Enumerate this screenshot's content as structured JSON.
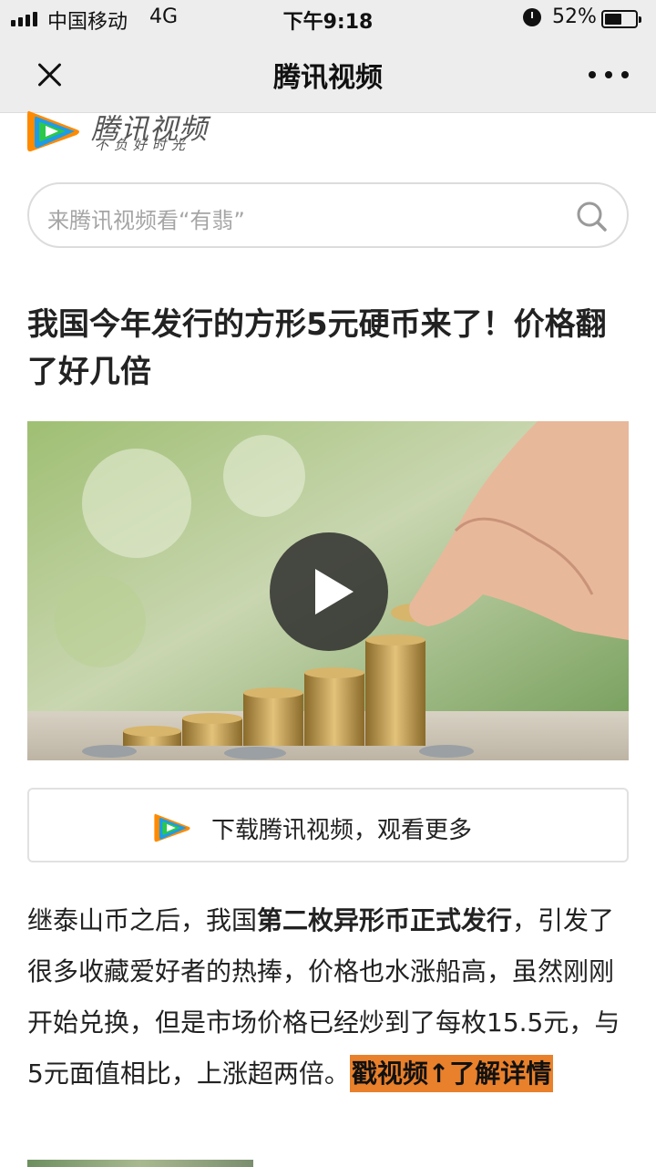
{
  "status_bar": {
    "carrier": "中国移动",
    "network": "4G",
    "time": "下午9:18",
    "battery": "52%",
    "battery_level": 0.52
  },
  "nav": {
    "title": "腾讯视频",
    "close_icon": "close-icon",
    "more_icon": "more-icon"
  },
  "logo": {
    "name": "腾讯视频",
    "slogan": "不负好时光"
  },
  "search": {
    "placeholder": "来腾讯视频看“有翡”"
  },
  "article": {
    "headline": "我国今年发行的方形5元硬币来了！价格翻了好几倍",
    "body_start": "继泰山币之后，我国",
    "body_bold": "第二枚异形币正式发行",
    "body_rest": "，引发了很多收藏爱好者的热捧，价格也水涨船高，虽然刚刚开始兑换，但是市场价格已经炒到了每枚15.5元，与5元面值相比，上涨超两倍。",
    "cta": "戳视频↑了解详情"
  },
  "video": {
    "play_icon": "play-icon"
  },
  "download": {
    "label": "下载腾讯视频，观看更多"
  },
  "colors": {
    "cta_bg": "#e9802b",
    "logo_orange": "#ff8a00",
    "logo_blue": "#1e9be8",
    "logo_green": "#2bc84a"
  }
}
